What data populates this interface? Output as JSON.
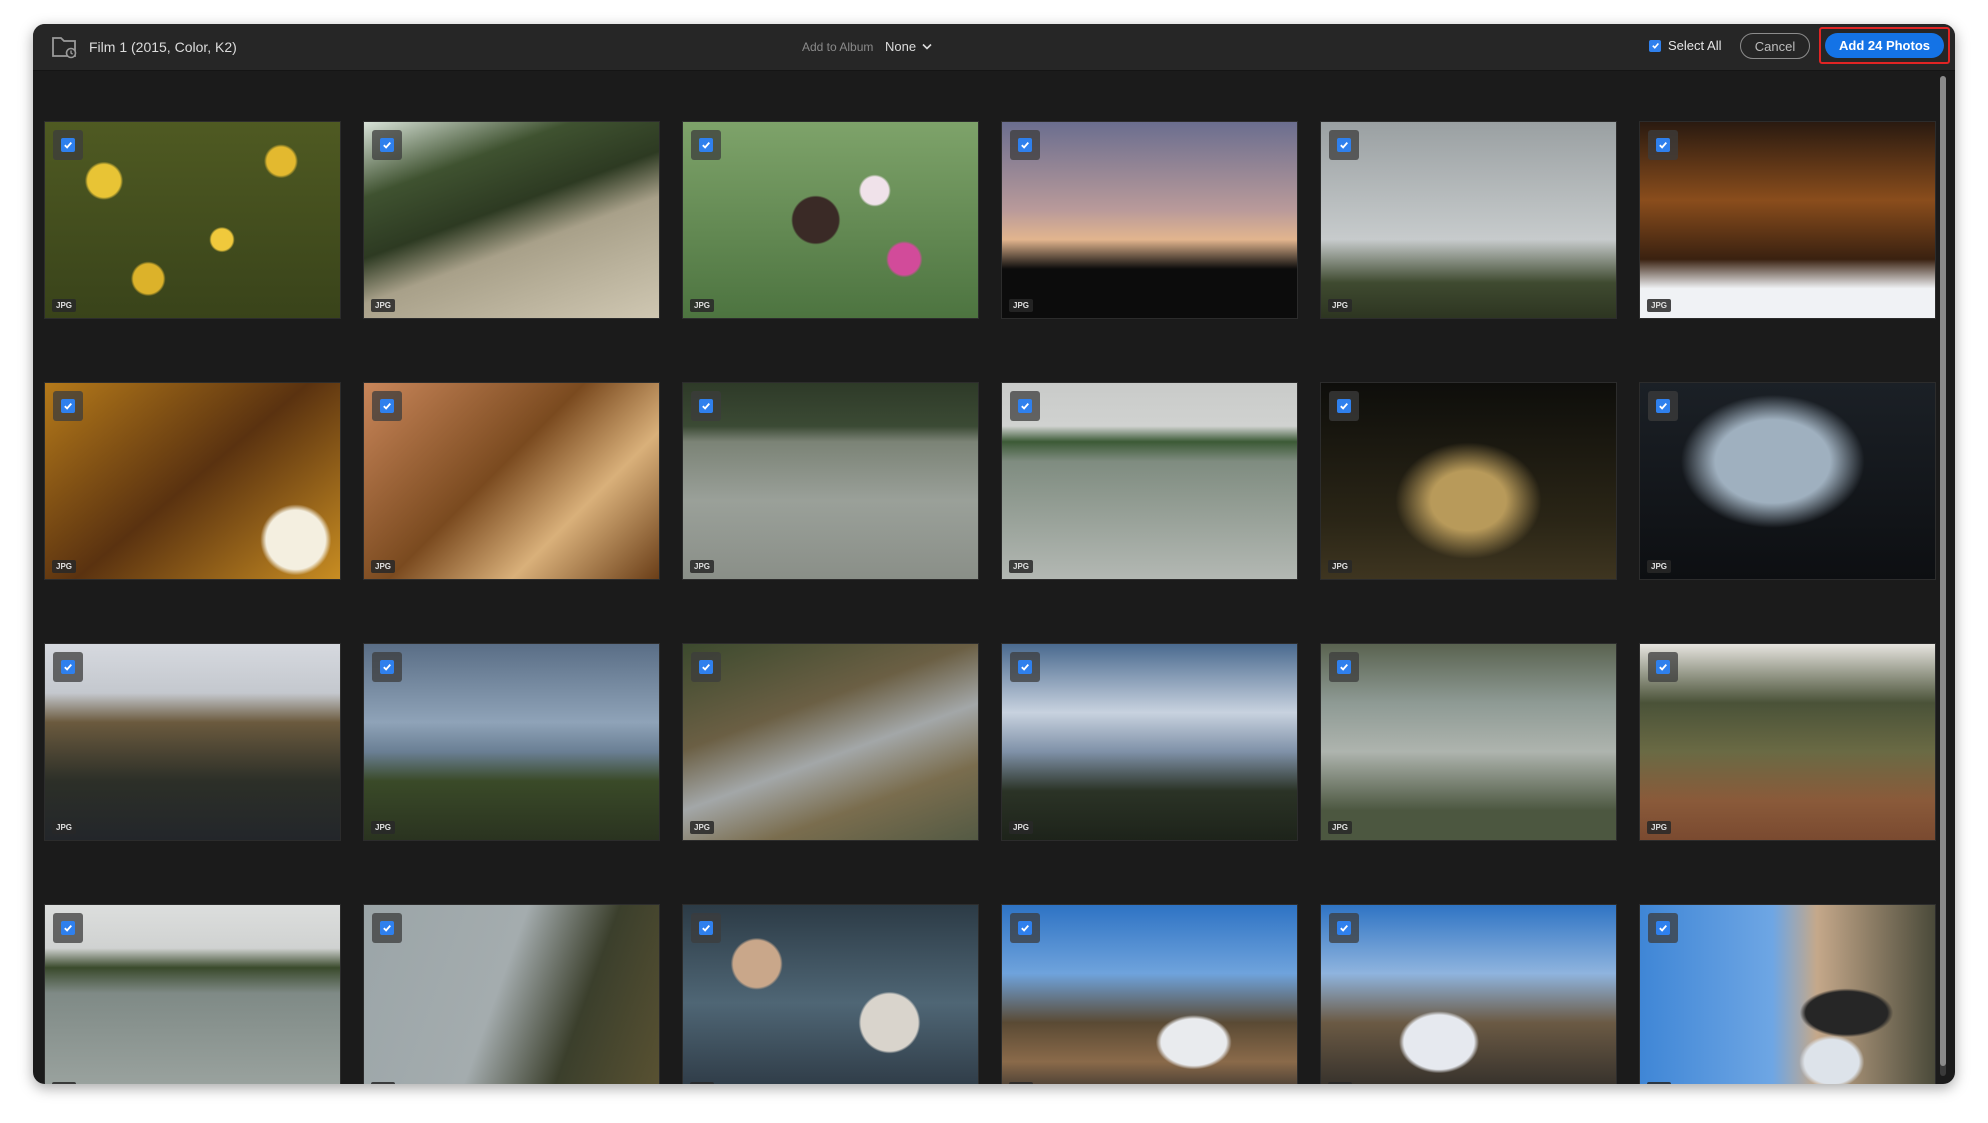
{
  "toolbar": {
    "title": "Film 1 (2015, Color, K2)",
    "add_to_album_label": "Add to Album",
    "album_value": "None",
    "select_all_label": "Select All",
    "cancel_label": "Cancel",
    "add_button_label": "Add 24 Photos",
    "accent_color": "#1473e6",
    "highlight_color": "#e02424"
  },
  "photos": [
    {
      "badge": "JPG",
      "subject": "sunflower-field",
      "selected": true
    },
    {
      "badge": "JPG",
      "subject": "forest-stream",
      "selected": true
    },
    {
      "badge": "JPG",
      "subject": "butterfly-on-flower",
      "selected": true
    },
    {
      "badge": "JPG",
      "subject": "silhouette-sunset",
      "selected": true
    },
    {
      "badge": "JPG",
      "subject": "overcast-field",
      "selected": true
    },
    {
      "badge": "JPG",
      "subject": "autumn-tree-sky",
      "selected": true
    },
    {
      "badge": "JPG",
      "subject": "autumn-branches",
      "selected": true
    },
    {
      "badge": "JPG",
      "subject": "autumn-canopy",
      "selected": true
    },
    {
      "badge": "JPG",
      "subject": "lake-reflection",
      "selected": true
    },
    {
      "badge": "JPG",
      "subject": "lake-treeline",
      "selected": true
    },
    {
      "badge": "JPG",
      "subject": "night-bench",
      "selected": true
    },
    {
      "badge": "JPG",
      "subject": "car-interior",
      "selected": true
    },
    {
      "badge": "JPG",
      "subject": "two-hikers",
      "selected": true
    },
    {
      "badge": "JPG",
      "subject": "mountain-overlook",
      "selected": true
    },
    {
      "badge": "JPG",
      "subject": "rocky-trail",
      "selected": true
    },
    {
      "badge": "JPG",
      "subject": "cloudy-sky-trees",
      "selected": true
    },
    {
      "badge": "JPG",
      "subject": "river-rocks",
      "selected": true
    },
    {
      "badge": "JPG",
      "subject": "woman-in-woods",
      "selected": true
    },
    {
      "badge": "JPG",
      "subject": "wide-river",
      "selected": true
    },
    {
      "badge": "JPG",
      "subject": "river-branches",
      "selected": true
    },
    {
      "badge": "JPG",
      "subject": "rocky-creek",
      "selected": true
    },
    {
      "badge": "JPG",
      "subject": "couple-at-falls",
      "selected": true
    },
    {
      "badge": "JPG",
      "subject": "couple-by-railing",
      "selected": true
    },
    {
      "badge": "JPG",
      "subject": "couple-sideways",
      "selected": true
    }
  ]
}
